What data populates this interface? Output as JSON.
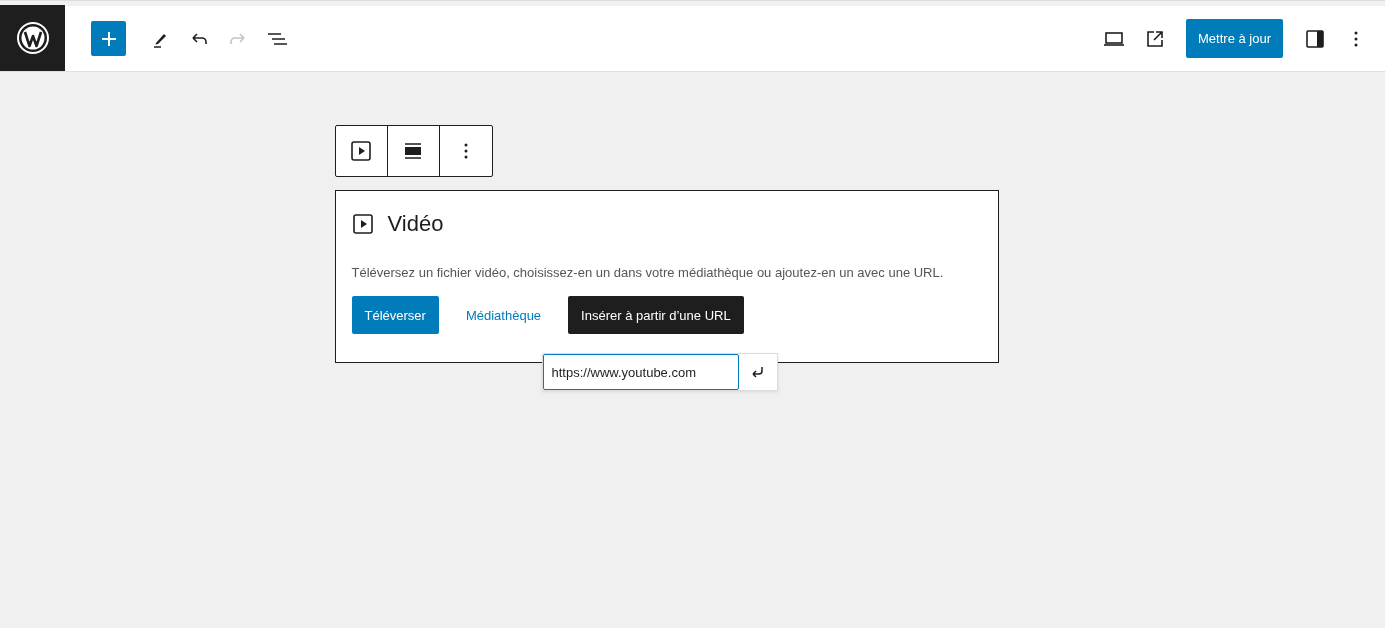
{
  "header": {
    "undo": {
      "disabled": false
    },
    "redo": {
      "disabled": true
    },
    "update_button": "Mettre à jour"
  },
  "block": {
    "title": "Vidéo",
    "description": "Téléversez un fichier vidéo, choisissez-en un dans votre médiathèque ou ajoutez-en un avec une URL.",
    "buttons": [
      {
        "label": "Téléverser",
        "kind": "primary"
      },
      {
        "label": "Médiathèque",
        "kind": "link"
      },
      {
        "label": "Insérer à partir d’une URL",
        "kind": "dark"
      }
    ],
    "url_popover": {
      "value": "https://www.youtube.com"
    }
  }
}
